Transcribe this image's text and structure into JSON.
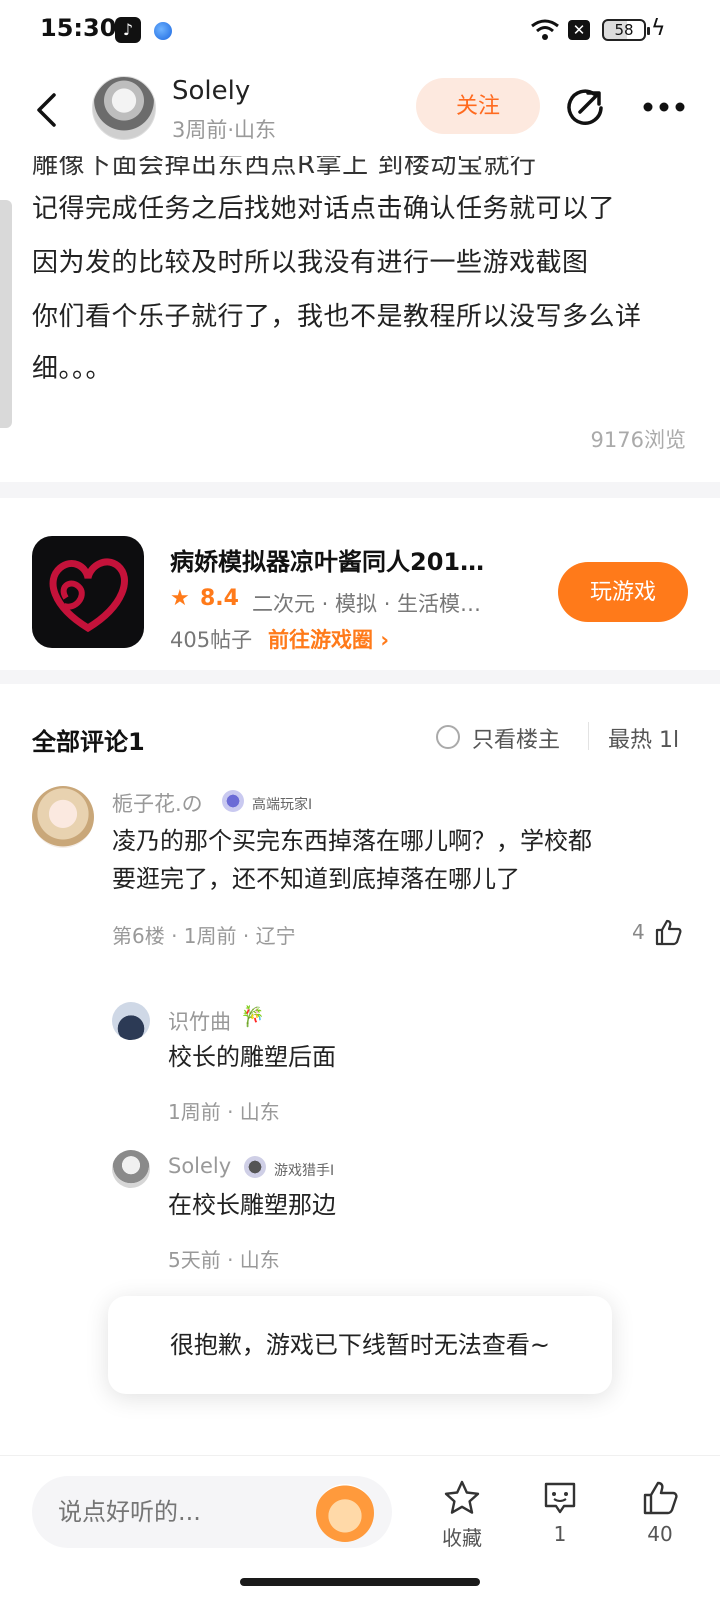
{
  "status_bar": {
    "time": "15:30",
    "battery": "58",
    "icons": [
      "tiktok-icon",
      "app-dot-icon",
      "wifi-icon",
      "x-notification-icon",
      "battery-icon",
      "charging-bolt-icon"
    ]
  },
  "header": {
    "author_name": "Solely",
    "author_meta": "3周前·山东",
    "follow_label": "关注",
    "icons": [
      "back-icon",
      "share-icon",
      "more-icon"
    ]
  },
  "article": {
    "cut_line": "雕像下面会掉出东西点R拿上 到楼动宝就行",
    "lines": [
      "记得完成任务之后找她对话点击确认任务就可以了",
      "因为发的比较及时所以我没有进行一些游戏截图",
      "你们看个乐子就行了，我也不是教程所以没写多么详",
      "细。。。"
    ],
    "views": "9176浏览"
  },
  "game": {
    "title": "病娇模拟器凉叶酱同人201…",
    "rating": "8.4",
    "tags": "二次元 · 模拟 · 生活模…",
    "posts": "405帖子",
    "circle_link": "前往游戏圈",
    "play_label": "玩游戏",
    "accent": "#ff7a1a"
  },
  "comments": {
    "title": "全部评论1",
    "only_op": "只看楼主",
    "sort": "最热 1l",
    "items": [
      {
        "name": "栀子花.の",
        "badge": "高端玩家I",
        "text_line1": "凌乃的那个买完东西掉落在哪儿啊？，学校都",
        "text_line2": "要逛完了，还不知道到底掉落在哪儿了",
        "meta": "第6楼 · 1周前 · 辽宁",
        "likes": "4"
      }
    ],
    "replies": [
      {
        "name": "识竹曲",
        "text": "校长的雕塑后面",
        "meta": "1周前 · 山东"
      },
      {
        "name": "Solely",
        "badge": "游戏猎手I",
        "text": "在校长雕塑那边",
        "meta": "5天前 · 山东"
      }
    ]
  },
  "toast": {
    "text": "很抱歉，游戏已下线暂时无法查看~"
  },
  "bottom_bar": {
    "input_placeholder": "说点好听的...",
    "collect_label": "收藏",
    "comment_count": "1",
    "like_count": "40"
  }
}
